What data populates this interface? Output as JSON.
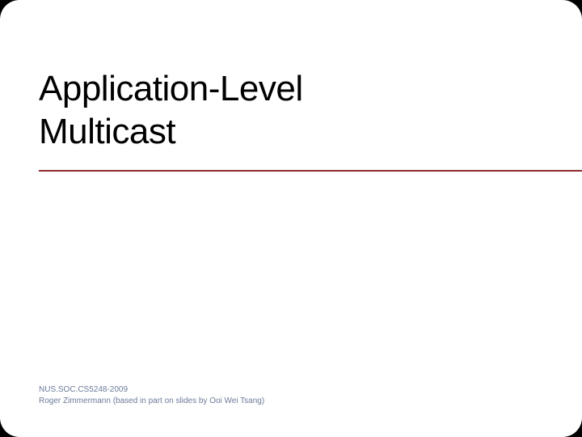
{
  "slide": {
    "title_line1": "Application-Level",
    "title_line2": "Multicast",
    "footer_line1": "NUS.SOC.CS5248-2009",
    "footer_line2": "Roger Zimmermann (based in part on slides by Ooi Wei Tsang)"
  }
}
